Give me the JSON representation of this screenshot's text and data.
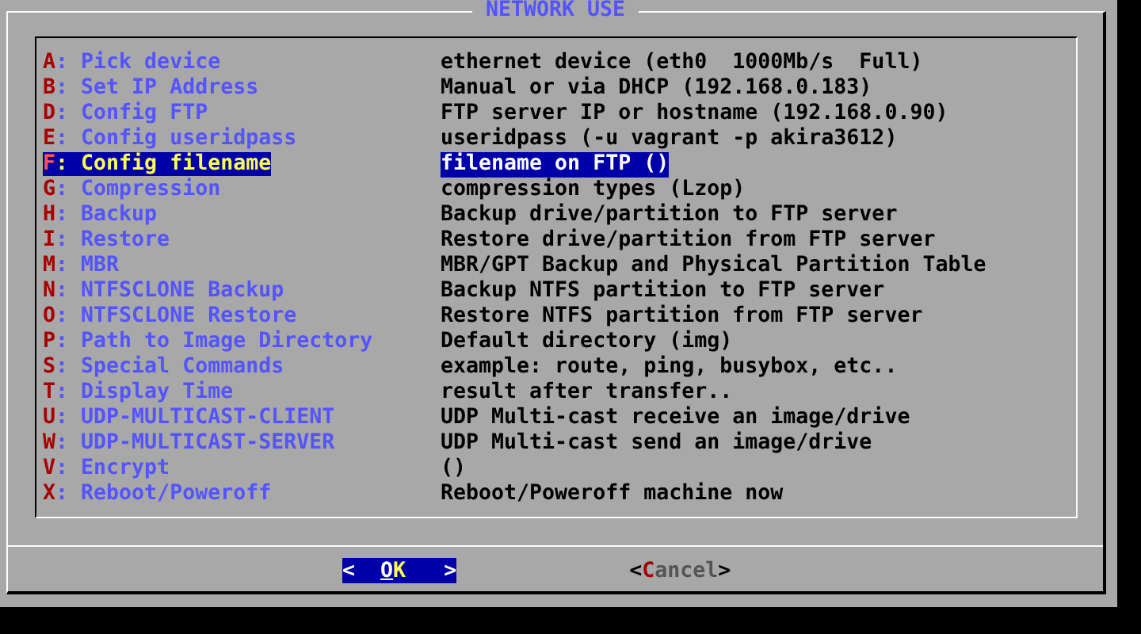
{
  "window": {
    "title": "NETWORK USE"
  },
  "items": [
    {
      "option": "A: Pick device",
      "description": "ethernet device (eth0  1000Mb/s  Full)",
      "selected": false
    },
    {
      "option": "B: Set IP Address",
      "description": "Manual or via DHCP (192.168.0.183)",
      "selected": false
    },
    {
      "option": "D: Config FTP",
      "description": "FTP server IP or hostname (192.168.0.90)",
      "selected": false
    },
    {
      "option": "E: Config useridpass",
      "description": "useridpass (-u vagrant -p akira3612)",
      "selected": false
    },
    {
      "option": "F: Config filename",
      "description": "filename on FTP ()",
      "selected": true
    },
    {
      "option": "G: Compression",
      "description": "compression types (Lzop)",
      "selected": false
    },
    {
      "option": "H: Backup",
      "description": "Backup drive/partition to FTP server",
      "selected": false
    },
    {
      "option": "I: Restore",
      "description": "Restore drive/partition from FTP server",
      "selected": false
    },
    {
      "option": "M: MBR",
      "description": "MBR/GPT Backup and Physical Partition Table",
      "selected": false
    },
    {
      "option": "N: NTFSCLONE Backup",
      "description": "Backup NTFS partition to FTP server",
      "selected": false
    },
    {
      "option": "O: NTFSCLONE Restore",
      "description": "Restore NTFS partition from FTP server",
      "selected": false
    },
    {
      "option": "P: Path to Image Directory",
      "description": "Default directory (img)",
      "selected": false
    },
    {
      "option": "S: Special Commands",
      "description": "example: route, ping, busybox, etc..",
      "selected": false
    },
    {
      "option": "T: Display Time",
      "description": "result after transfer..",
      "selected": false
    },
    {
      "option": "U: UDP-MULTICAST-CLIENT",
      "description": "UDP Multi-cast receive an image/drive",
      "selected": false
    },
    {
      "option": "W: UDP-MULTICAST-SERVER",
      "description": "UDP Multi-cast send an image/drive",
      "selected": false
    },
    {
      "option": "V: Encrypt",
      "description": "()",
      "selected": false
    },
    {
      "option": "X: Reboot/Poweroff",
      "description": "Reboot/Poweroff machine now",
      "selected": false
    }
  ],
  "buttons": [
    {
      "open": "<",
      "label": "OK",
      "close": ">",
      "selected": true
    },
    {
      "open": "<",
      "label": "Cancel",
      "close": ">",
      "selected": false
    }
  ]
}
